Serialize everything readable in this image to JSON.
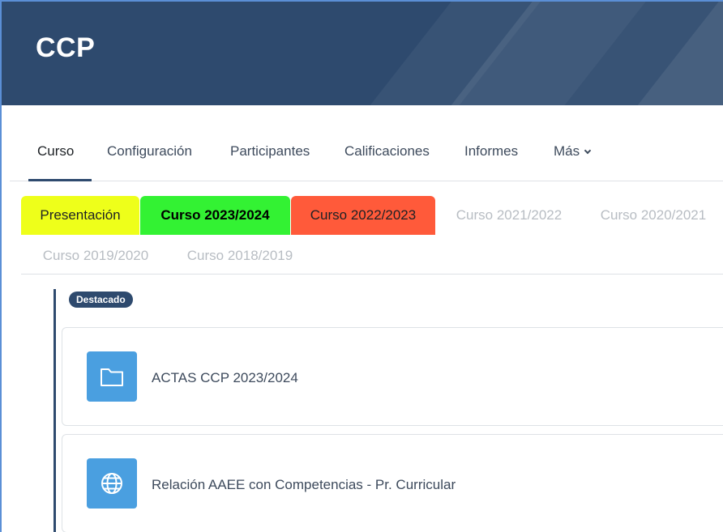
{
  "banner": {
    "title": "CCP"
  },
  "nav": {
    "items": [
      {
        "label": "Curso"
      },
      {
        "label": "Configuración"
      },
      {
        "label": "Participantes"
      },
      {
        "label": "Calificaciones"
      },
      {
        "label": "Informes"
      },
      {
        "label": "Más"
      }
    ]
  },
  "tabs": [
    {
      "label": "Presentación",
      "bg": "#eeff1a",
      "color": "#1d2125"
    },
    {
      "label": "Curso 2023/2024",
      "bg": "#33f233",
      "color": "#000000"
    },
    {
      "label": "Curso 2022/2023",
      "bg": "#ff5a3a",
      "color": "#1d2125"
    },
    {
      "label": "Curso 2021/2022"
    },
    {
      "label": "Curso 2020/2021"
    },
    {
      "label": "Curso 2019/2020"
    },
    {
      "label": "Curso 2018/2019"
    }
  ],
  "section": {
    "badge": "Destacado",
    "activities": [
      {
        "label": "ACTAS CCP 2023/2024",
        "icon": "folder-icon"
      },
      {
        "label": "Relación AAEE con Competencias - Pr. Curricular",
        "icon": "globe-icon"
      }
    ]
  },
  "colors": {
    "brand": "#2e4a6e",
    "icon_bg": "#4a9fe0"
  }
}
